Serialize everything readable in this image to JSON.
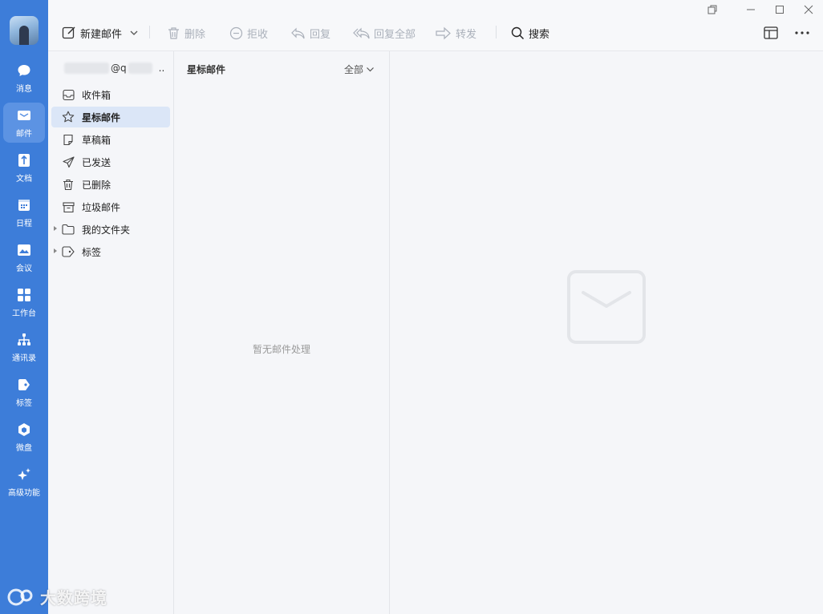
{
  "window": {
    "controls": [
      "pin-icon",
      "minimize-icon",
      "maximize-icon",
      "close-icon"
    ]
  },
  "toolbar": {
    "compose_label": "新建邮件",
    "delete_label": "删除",
    "reject_label": "拒收",
    "reply_label": "回复",
    "reply_all_label": "回复全部",
    "forward_label": "转发",
    "search_label": "搜索"
  },
  "nav": {
    "items": [
      {
        "label": "消息",
        "icon": "message-icon"
      },
      {
        "label": "邮件",
        "icon": "mail-icon",
        "active": true
      },
      {
        "label": "文档",
        "icon": "document-icon"
      },
      {
        "label": "日程",
        "icon": "calendar-icon"
      },
      {
        "label": "会议",
        "icon": "meeting-icon"
      },
      {
        "label": "工作台",
        "icon": "workbench-icon"
      },
      {
        "label": "通讯录",
        "icon": "contacts-icon"
      },
      {
        "label": "标签",
        "icon": "tag-icon"
      },
      {
        "label": "微盘",
        "icon": "drive-icon"
      },
      {
        "label": "高级功能",
        "icon": "sparkle-icon"
      }
    ]
  },
  "account": {
    "email_visible": "@q",
    "ellipsis": ".."
  },
  "folders": [
    {
      "label": "收件箱",
      "icon": "inbox-icon"
    },
    {
      "label": "星标邮件",
      "icon": "star-icon",
      "active": true
    },
    {
      "label": "草稿箱",
      "icon": "draft-icon"
    },
    {
      "label": "已发送",
      "icon": "sent-icon"
    },
    {
      "label": "已删除",
      "icon": "trash-icon"
    },
    {
      "label": "垃圾邮件",
      "icon": "spam-icon"
    },
    {
      "label": "我的文件夹",
      "icon": "folder-icon",
      "expandable": true
    },
    {
      "label": "标签",
      "icon": "label-icon",
      "expandable": true
    }
  ],
  "list": {
    "title": "星标邮件",
    "filter": "全部",
    "empty_text": "暂无邮件处理"
  },
  "watermark": "大数跨境",
  "colors": {
    "rail": "#3d7dd9",
    "rail_active": "#5c93e3",
    "folder_active": "#dbe6f7",
    "background": "#f5f6f9"
  }
}
